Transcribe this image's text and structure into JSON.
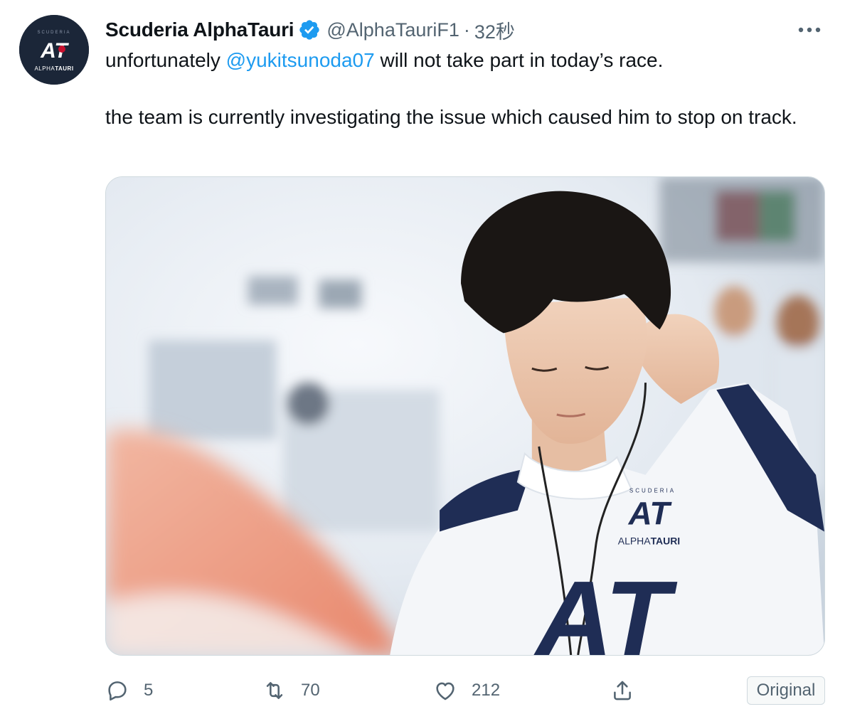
{
  "tweet": {
    "display_name": "Scuderia AlphaTauri",
    "handle": "@AlphaTauriF1",
    "separator": "·",
    "time": "32秒",
    "text_before_mention": "unfortunately ",
    "mention": "@yukitsunoda07",
    "text_after_mention": " will not take part in today’s race.",
    "paragraph2": "the team is currently investigating the issue which caused him to stop on track."
  },
  "avatar": {
    "top_text": "SCUDERIA",
    "logo_text": "AT",
    "brand_prefix": "ALPHA",
    "brand_suffix": "TAURI"
  },
  "media": {
    "suit_logo_text": "AT",
    "suit_brand_prefix": "ALPHA",
    "suit_brand_suffix": "TAURI",
    "suit_scuderia": "SCUDERIA",
    "chest_text": "AT"
  },
  "actions": {
    "reply_count": "5",
    "retweet_count": "70",
    "like_count": "212"
  },
  "original_button": "Original",
  "colors": {
    "accent": "#1d9bf0",
    "secondary_text": "#536471",
    "team_navy": "#1b2638"
  }
}
